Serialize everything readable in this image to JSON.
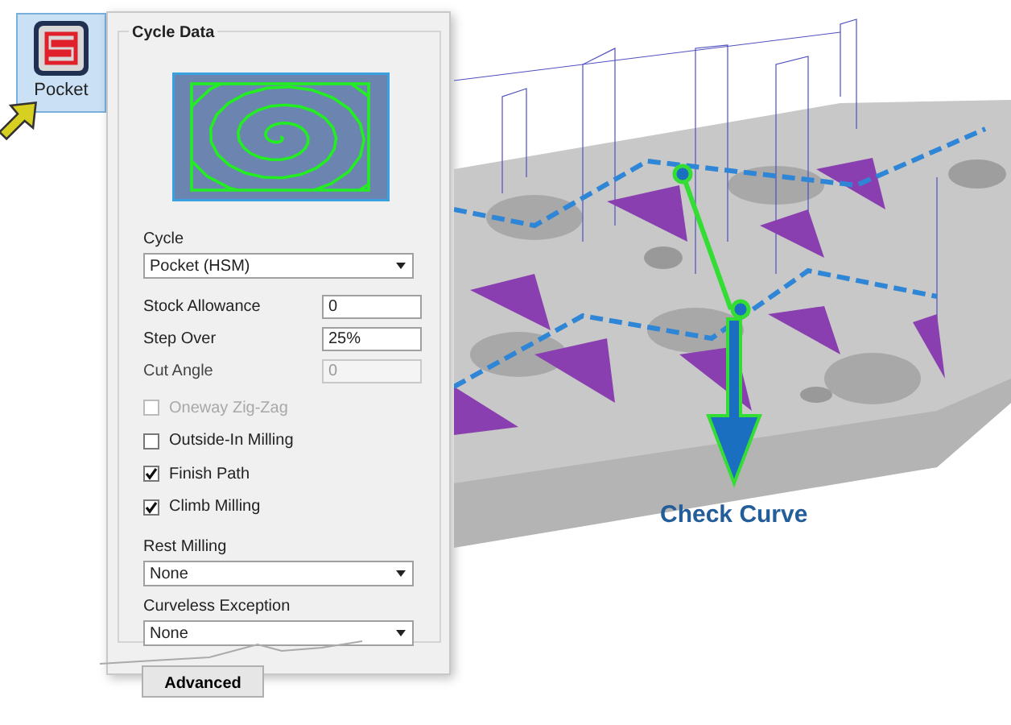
{
  "tool_button": {
    "label": "Pocket",
    "selected": true
  },
  "panel": {
    "title": "Cycle Data",
    "fields": [
      {
        "kind": "select",
        "label": "Cycle",
        "value": "Pocket (HSM)"
      },
      {
        "kind": "input",
        "label": "Stock Allowance",
        "value": "0",
        "disabled": false
      },
      {
        "kind": "input",
        "label": "Step Over",
        "value": "25%",
        "disabled": false
      },
      {
        "kind": "input",
        "label": "Cut Angle",
        "value": "0",
        "disabled": true
      },
      {
        "kind": "checkbox",
        "label": "Oneway Zig-Zag",
        "checked": false,
        "disabled": true
      },
      {
        "kind": "checkbox",
        "label": "Outside-In Milling",
        "checked": false,
        "disabled": false
      },
      {
        "kind": "checkbox",
        "label": "Finish Path",
        "checked": true,
        "disabled": false
      },
      {
        "kind": "checkbox",
        "label": "Climb Milling",
        "checked": true,
        "disabled": false
      },
      {
        "kind": "select",
        "label": "Rest Milling",
        "value": "None"
      },
      {
        "kind": "select",
        "label": "Curveless Exception",
        "value": "None"
      }
    ],
    "advanced_button": "Advanced"
  },
  "callout": "Check Curve"
}
